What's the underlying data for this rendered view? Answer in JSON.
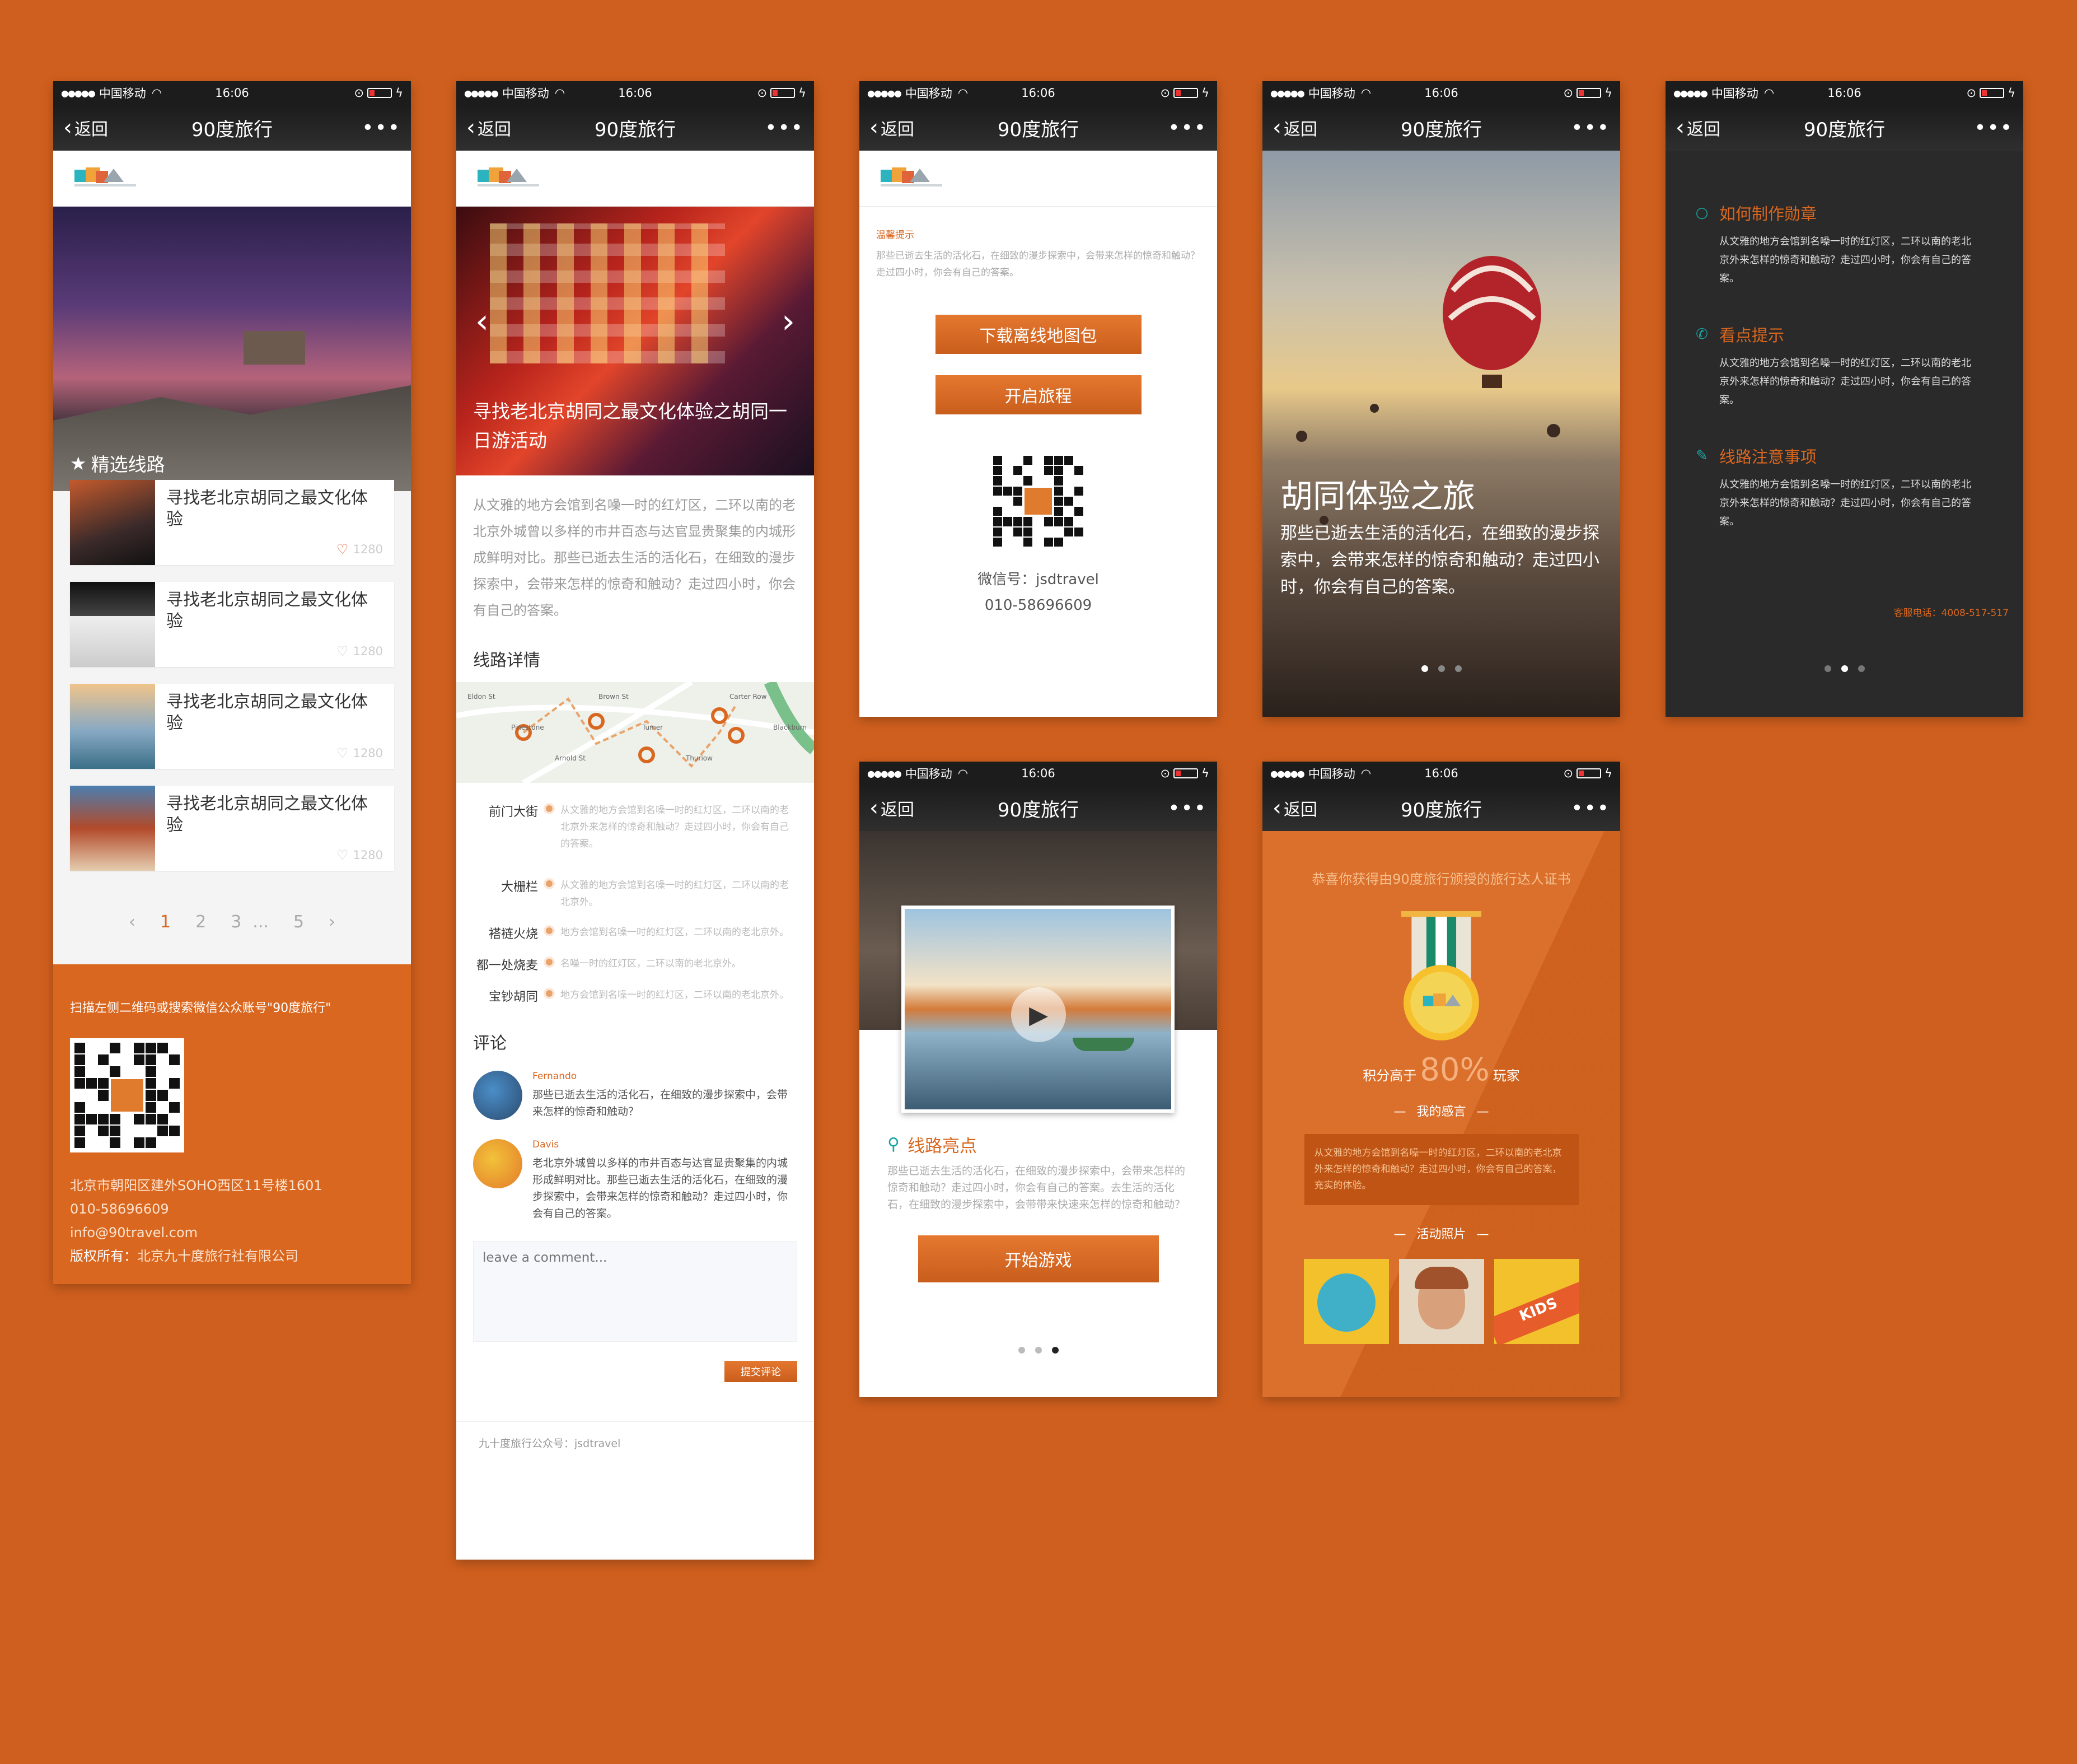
{
  "status": {
    "carrier": "中国移动",
    "time": "16:06"
  },
  "nav": {
    "back": "返回",
    "title": "90度旅行"
  },
  "s1": {
    "featured": "精选线路",
    "item_title": "寻找老北京胡同之最文化体验",
    "item_likes": "1280",
    "pages": [
      "1",
      "2",
      "3",
      "...",
      "5"
    ],
    "footer_scan": "扫描左侧二维码或搜索微信公众账号\"90度旅行\"",
    "address": "北京市朝阳区建外SOHO西区11号楼1601",
    "phone": "010-58696609",
    "email": "info@90travel.com",
    "copyright_label": "版权所有：",
    "copyright_value": "北京九十度旅行社有限公司"
  },
  "s2": {
    "hero_title": "寻找老北京胡同之最文化体验之胡同一日游活动",
    "intro": "从文雅的地方会馆到名噪一时的红灯区，二环以南的老北京外城曾以多样的市井百态与达官显贵聚集的内城形成鲜明对比。那些已逝去生活的活化石，在细致的漫步探索中，会带来怎样的惊奇和触动？走过四小时，你会有自己的答案。",
    "route_heading": "线路详情",
    "map_streets": [
      "Eldon St",
      "Pinestone",
      "Arnold St",
      "Brown St",
      "Tumer",
      "Thuriow",
      "Carter Row",
      "Blackburn"
    ],
    "stops": [
      {
        "name": "前门大街",
        "desc": "从文雅的地方会馆到名噪一时的红灯区，二环以南的老北京外来怎样的惊奇和触动？走过四小时，你会有自己的答案。"
      },
      {
        "name": "大栅栏",
        "desc": "从文雅的地方会馆到名噪一时的红灯区，二环以南的老北京外。"
      },
      {
        "name": "褡裢火烧",
        "desc": "地方会馆到名噪一时的红灯区，二环以南的老北京外。"
      },
      {
        "name": "都一处烧麦",
        "desc": "名噪一时的红灯区，二环以南的老北京外。"
      },
      {
        "name": "宝钞胡同",
        "desc": "地方会馆到名噪一时的红灯区，二环以南的老北京外。"
      }
    ],
    "comments_heading": "评论",
    "comments": [
      {
        "user": "Fernando",
        "text": "那些已逝去生活的活化石，在细致的漫步探索中，会带来怎样的惊奇和触动？"
      },
      {
        "user": "Davis",
        "text": "老北京外城曾以多样的市井百态与达官显贵聚集的内城形成鲜明对比。那些已逝去生活的活化石，在细致的漫步探索中，会带来怎样的惊奇和触动？走过四小时，你会有自己的答案。"
      }
    ],
    "comment_placeholder": "leave a comment...",
    "submit": "提交评论",
    "footer": "九十度旅行公众号：jsdtravel"
  },
  "s3": {
    "tip_label": "温馨提示",
    "tip_text": "那些已逝去生活的活化石，在细致的漫步探索中，会带来怎样的惊奇和触动？走过四小时，你会有自己的答案。",
    "download": "下载离线地图包",
    "start": "开启旅程",
    "wechat": "微信号：jsdtravel",
    "phone": "010-58696609"
  },
  "s4": {
    "title": "胡同体验之旅",
    "text": "那些已逝去生活的活化石，在细致的漫步探索中，会带来怎样的惊奇和触动？走过四小时，你会有自己的答案。"
  },
  "s5": {
    "sections": [
      {
        "title": "如何制作勋章",
        "text": "从文雅的地方会馆到名噪一时的红灯区，二环以南的老北京外来怎样的惊奇和触动？走过四小时，你会有自己的答案。"
      },
      {
        "title": "看点提示",
        "text": "从文雅的地方会馆到名噪一时的红灯区，二环以南的老北京外来怎样的惊奇和触动？走过四小时，你会有自己的答案。"
      },
      {
        "title": "线路注意事项",
        "text": "从文雅的地方会馆到名噪一时的红灯区，二环以南的老北京外来怎样的惊奇和触动？走过四小时，你会有自己的答案。"
      }
    ],
    "hotline": "客服电话：4008-517-517"
  },
  "s6": {
    "highlights": "线路亮点",
    "text": "那些已逝去生活的活化石，在细致的漫步探索中，会带来怎样的惊奇和触动？走过四小时，你会有自己的答案。去生活的活化石，在细致的漫步探索中，会带带来快速来怎样的惊奇和触动？",
    "start": "开始游戏"
  },
  "s7": {
    "congrats": "恭喜你获得由90度旅行颁授的旅行达人证书",
    "score_prefix": "积分高于",
    "score": "80%",
    "score_suffix": "玩家",
    "feelings": "我的感言",
    "feelings_text": "从文雅的地方会馆到名噪一时的红灯区，二环以南的老北京外来怎样的惊奇和触动？走过四小时，你会有自己的答案，充实的体验。",
    "photos": "活动照片",
    "kids": "KIDS"
  },
  "colors": {
    "bg": "#cf5f1e",
    "accent": "#d9671f",
    "dark": "#1c1c1c"
  }
}
